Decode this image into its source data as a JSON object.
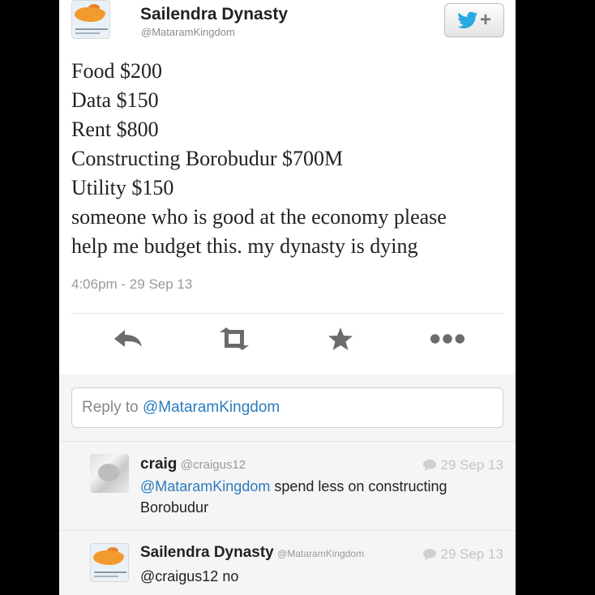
{
  "tweet": {
    "author_name": "Sailendra Dynasty",
    "author_handle": "@MataramKingdom",
    "lines": [
      "Food $200",
      "Data $150",
      "Rent $800",
      "Constructing Borobudur $700M",
      "Utility $150",
      "someone who is good at the economy please",
      "help me budget this. my dynasty is dying"
    ],
    "timestamp": "4:06pm - 29 Sep 13"
  },
  "follow_button": {
    "plus": "+"
  },
  "reply_box": {
    "prefix": "Reply to ",
    "mention": "@MataramKingdom"
  },
  "replies": [
    {
      "name": "craig",
      "handle": "@craigus12",
      "date": "29 Sep 13",
      "mention": "@MataramKingdom",
      "text_line1": " spend less on constructing",
      "text_line2": "Borobudur"
    },
    {
      "name": "Sailendra Dynasty",
      "handle": "@MataramKingdom",
      "date": "29 Sep 13",
      "text": "@craigus12 no"
    }
  ],
  "colors": {
    "link": "#2a7bbf",
    "twitter_blue": "#2aa9e0"
  }
}
